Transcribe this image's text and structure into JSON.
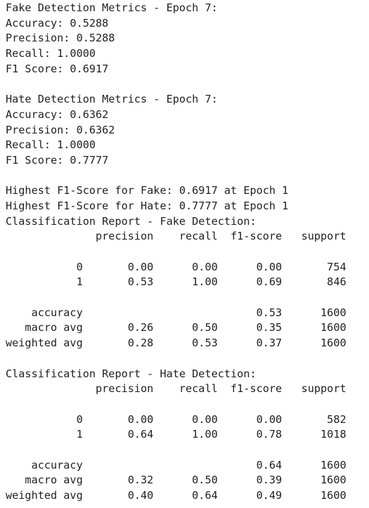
{
  "output": {
    "lines": [
      "Fake Detection Metrics - Epoch 7:",
      "Accuracy: 0.5288",
      "Precision: 0.5288",
      "Recall: 1.0000",
      "F1 Score: 0.6917",
      "",
      "Hate Detection Metrics - Epoch 7:",
      "Accuracy: 0.6362",
      "Precision: 0.6362",
      "Recall: 1.0000",
      "F1 Score: 0.7777",
      "",
      "Highest F1-Score for Fake: 0.6917 at Epoch 1",
      "Highest F1-Score for Hate: 0.7777 at Epoch 1",
      "Classification Report - Fake Detection:",
      "              precision    recall  f1-score   support",
      "",
      "           0       0.00      0.00      0.00       754",
      "           1       0.53      1.00      0.69       846",
      "",
      "    accuracy                           0.53      1600",
      "   macro avg       0.26      0.50      0.35      1600",
      "weighted avg       0.28      0.53      0.37      1600",
      "",
      "Classification Report - Hate Detection:",
      "              precision    recall  f1-score   support",
      "",
      "           0       0.00      0.00      0.00       582",
      "           1       0.64      1.00      0.78      1018",
      "",
      "    accuracy                           0.64      1600",
      "   macro avg       0.32      0.50      0.39      1600",
      "weighted avg       0.40      0.64      0.49      1600"
    ]
  }
}
